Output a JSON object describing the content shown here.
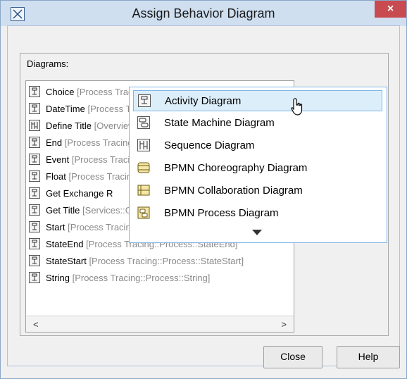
{
  "window": {
    "title": "Assign Behavior Diagram",
    "close_glyph": "×"
  },
  "panel": {
    "label": "Diagrams:"
  },
  "list": {
    "items": [
      {
        "name": "Choice",
        "path": "[Process Tracing::Process::Choice]"
      },
      {
        "name": "DateTime",
        "path": "[Process Tracing::Process::DateTime]"
      },
      {
        "name": "Define Title",
        "path": "[Overview::Define Title]"
      },
      {
        "name": "End",
        "path": "[Process Tracing::Process::End]"
      },
      {
        "name": "Event",
        "path": "[Process Tracing::Process::Event]"
      },
      {
        "name": "Float",
        "path": "[Process Tracing::Process::Float]"
      },
      {
        "name": "Get Exchange R",
        "path": ""
      },
      {
        "name": "Get Title",
        "path": "[Services::Get Title]"
      },
      {
        "name": "Start",
        "path": "[Process Tracing::Process::Start]"
      },
      {
        "name": "StateEnd",
        "path": "[Process Tracing::Process::StateEnd]"
      },
      {
        "name": "StateStart",
        "path": "[Process Tracing::Process::StateStart]"
      },
      {
        "name": "String",
        "path": "[Process Tracing::Process::String]"
      }
    ],
    "scroll_left": "<",
    "scroll_right": ">"
  },
  "popup": {
    "items": [
      {
        "label": "Activity Diagram",
        "icon": "activity-diagram-icon",
        "selected": true
      },
      {
        "label": "State Machine Diagram",
        "icon": "state-machine-icon",
        "selected": false
      },
      {
        "label": "Sequence Diagram",
        "icon": "sequence-diagram-icon",
        "selected": false
      },
      {
        "label": "BPMN Choreography Diagram",
        "icon": "bpmn-choreography-icon",
        "selected": false
      },
      {
        "label": "BPMN Collaboration Diagram",
        "icon": "bpmn-collaboration-icon",
        "selected": false
      },
      {
        "label": "BPMN Process Diagram",
        "icon": "bpmn-process-icon",
        "selected": false
      }
    ]
  },
  "buttons": {
    "close": "Close",
    "help": "Help"
  },
  "colors": {
    "title_bar": "#cfdff0",
    "close_button": "#c74b50",
    "selection": "#ddeefb",
    "selection_border": "#7fb6e8",
    "path_text": "#8a8a8a"
  }
}
